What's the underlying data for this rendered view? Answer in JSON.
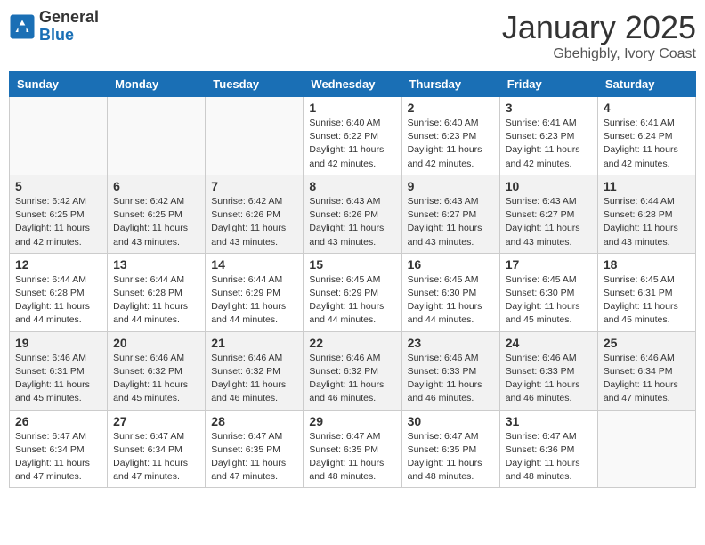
{
  "header": {
    "logo_line1": "General",
    "logo_line2": "Blue",
    "month": "January 2025",
    "location": "Gbehigbly, Ivory Coast"
  },
  "weekdays": [
    "Sunday",
    "Monday",
    "Tuesday",
    "Wednesday",
    "Thursday",
    "Friday",
    "Saturday"
  ],
  "weeks": [
    [
      {
        "day": "",
        "info": ""
      },
      {
        "day": "",
        "info": ""
      },
      {
        "day": "",
        "info": ""
      },
      {
        "day": "1",
        "info": "Sunrise: 6:40 AM\nSunset: 6:22 PM\nDaylight: 11 hours\nand 42 minutes."
      },
      {
        "day": "2",
        "info": "Sunrise: 6:40 AM\nSunset: 6:23 PM\nDaylight: 11 hours\nand 42 minutes."
      },
      {
        "day": "3",
        "info": "Sunrise: 6:41 AM\nSunset: 6:23 PM\nDaylight: 11 hours\nand 42 minutes."
      },
      {
        "day": "4",
        "info": "Sunrise: 6:41 AM\nSunset: 6:24 PM\nDaylight: 11 hours\nand 42 minutes."
      }
    ],
    [
      {
        "day": "5",
        "info": "Sunrise: 6:42 AM\nSunset: 6:25 PM\nDaylight: 11 hours\nand 42 minutes."
      },
      {
        "day": "6",
        "info": "Sunrise: 6:42 AM\nSunset: 6:25 PM\nDaylight: 11 hours\nand 43 minutes."
      },
      {
        "day": "7",
        "info": "Sunrise: 6:42 AM\nSunset: 6:26 PM\nDaylight: 11 hours\nand 43 minutes."
      },
      {
        "day": "8",
        "info": "Sunrise: 6:43 AM\nSunset: 6:26 PM\nDaylight: 11 hours\nand 43 minutes."
      },
      {
        "day": "9",
        "info": "Sunrise: 6:43 AM\nSunset: 6:27 PM\nDaylight: 11 hours\nand 43 minutes."
      },
      {
        "day": "10",
        "info": "Sunrise: 6:43 AM\nSunset: 6:27 PM\nDaylight: 11 hours\nand 43 minutes."
      },
      {
        "day": "11",
        "info": "Sunrise: 6:44 AM\nSunset: 6:28 PM\nDaylight: 11 hours\nand 43 minutes."
      }
    ],
    [
      {
        "day": "12",
        "info": "Sunrise: 6:44 AM\nSunset: 6:28 PM\nDaylight: 11 hours\nand 44 minutes."
      },
      {
        "day": "13",
        "info": "Sunrise: 6:44 AM\nSunset: 6:28 PM\nDaylight: 11 hours\nand 44 minutes."
      },
      {
        "day": "14",
        "info": "Sunrise: 6:44 AM\nSunset: 6:29 PM\nDaylight: 11 hours\nand 44 minutes."
      },
      {
        "day": "15",
        "info": "Sunrise: 6:45 AM\nSunset: 6:29 PM\nDaylight: 11 hours\nand 44 minutes."
      },
      {
        "day": "16",
        "info": "Sunrise: 6:45 AM\nSunset: 6:30 PM\nDaylight: 11 hours\nand 44 minutes."
      },
      {
        "day": "17",
        "info": "Sunrise: 6:45 AM\nSunset: 6:30 PM\nDaylight: 11 hours\nand 45 minutes."
      },
      {
        "day": "18",
        "info": "Sunrise: 6:45 AM\nSunset: 6:31 PM\nDaylight: 11 hours\nand 45 minutes."
      }
    ],
    [
      {
        "day": "19",
        "info": "Sunrise: 6:46 AM\nSunset: 6:31 PM\nDaylight: 11 hours\nand 45 minutes."
      },
      {
        "day": "20",
        "info": "Sunrise: 6:46 AM\nSunset: 6:32 PM\nDaylight: 11 hours\nand 45 minutes."
      },
      {
        "day": "21",
        "info": "Sunrise: 6:46 AM\nSunset: 6:32 PM\nDaylight: 11 hours\nand 46 minutes."
      },
      {
        "day": "22",
        "info": "Sunrise: 6:46 AM\nSunset: 6:32 PM\nDaylight: 11 hours\nand 46 minutes."
      },
      {
        "day": "23",
        "info": "Sunrise: 6:46 AM\nSunset: 6:33 PM\nDaylight: 11 hours\nand 46 minutes."
      },
      {
        "day": "24",
        "info": "Sunrise: 6:46 AM\nSunset: 6:33 PM\nDaylight: 11 hours\nand 46 minutes."
      },
      {
        "day": "25",
        "info": "Sunrise: 6:46 AM\nSunset: 6:34 PM\nDaylight: 11 hours\nand 47 minutes."
      }
    ],
    [
      {
        "day": "26",
        "info": "Sunrise: 6:47 AM\nSunset: 6:34 PM\nDaylight: 11 hours\nand 47 minutes."
      },
      {
        "day": "27",
        "info": "Sunrise: 6:47 AM\nSunset: 6:34 PM\nDaylight: 11 hours\nand 47 minutes."
      },
      {
        "day": "28",
        "info": "Sunrise: 6:47 AM\nSunset: 6:35 PM\nDaylight: 11 hours\nand 47 minutes."
      },
      {
        "day": "29",
        "info": "Sunrise: 6:47 AM\nSunset: 6:35 PM\nDaylight: 11 hours\nand 48 minutes."
      },
      {
        "day": "30",
        "info": "Sunrise: 6:47 AM\nSunset: 6:35 PM\nDaylight: 11 hours\nand 48 minutes."
      },
      {
        "day": "31",
        "info": "Sunrise: 6:47 AM\nSunset: 6:36 PM\nDaylight: 11 hours\nand 48 minutes."
      },
      {
        "day": "",
        "info": ""
      }
    ]
  ]
}
